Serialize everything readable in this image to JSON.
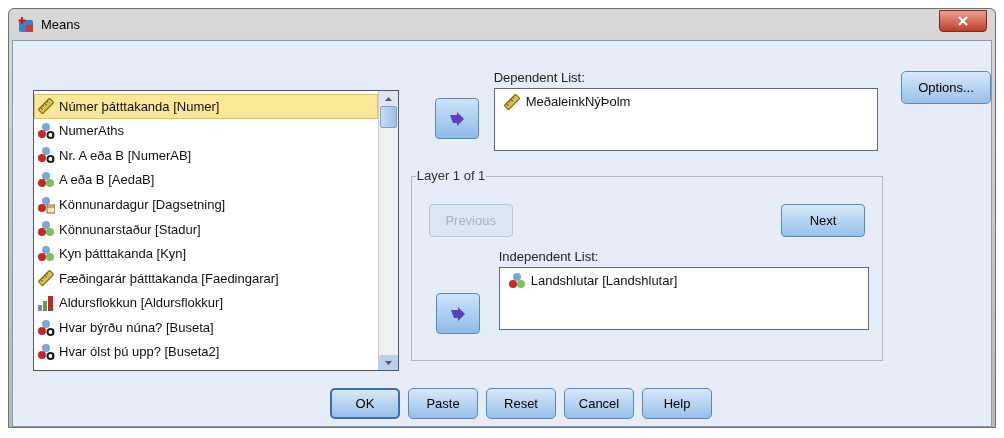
{
  "window": {
    "title": "Means"
  },
  "variables": [
    {
      "label": "Númer þátttakanda [Numer]",
      "kind": "scale",
      "selected": true
    },
    {
      "label": "NumerAths",
      "kind": "nominal_string",
      "selected": false
    },
    {
      "label": "Nr. A eða B [NumerAB]",
      "kind": "nominal_string",
      "selected": false
    },
    {
      "label": "A eða B [AedaB]",
      "kind": "nominal",
      "selected": false
    },
    {
      "label": "Könnunardagur [Dagsetning]",
      "kind": "nominal_date",
      "selected": false
    },
    {
      "label": "Könnunarstaður [Stadur]",
      "kind": "nominal",
      "selected": false
    },
    {
      "label": "Kyn þátttakanda [Kyn]",
      "kind": "nominal",
      "selected": false
    },
    {
      "label": "Fæðingarár þátttakanda [Faedingarar]",
      "kind": "scale",
      "selected": false
    },
    {
      "label": "Aldursflokkun [Aldursflokkur]",
      "kind": "ordinal",
      "selected": false
    },
    {
      "label": "Hvar býrðu núna? [Buseta]",
      "kind": "nominal_string",
      "selected": false
    },
    {
      "label": "Hvar ólst þú upp? [Buseta2]",
      "kind": "nominal_string",
      "selected": false
    }
  ],
  "dependent": {
    "label": "Dependent List:",
    "items": [
      {
        "label": "MeðaleinkNýÞolm",
        "kind": "scale"
      }
    ]
  },
  "layer": {
    "label": "Layer 1 of 1",
    "previous": {
      "label": "Previous",
      "disabled": true
    },
    "next": {
      "label": "Next",
      "disabled": false
    }
  },
  "independent": {
    "label": "Independent List:",
    "items": [
      {
        "label": "Landshlutar [Landshlutar]",
        "kind": "nominal"
      }
    ]
  },
  "options_button": {
    "label": "Options..."
  },
  "buttons": [
    {
      "label": "OK",
      "default": true
    },
    {
      "label": "Paste",
      "default": false
    },
    {
      "label": "Reset",
      "default": false
    },
    {
      "label": "Cancel",
      "default": false
    },
    {
      "label": "Help",
      "default": false
    }
  ]
}
